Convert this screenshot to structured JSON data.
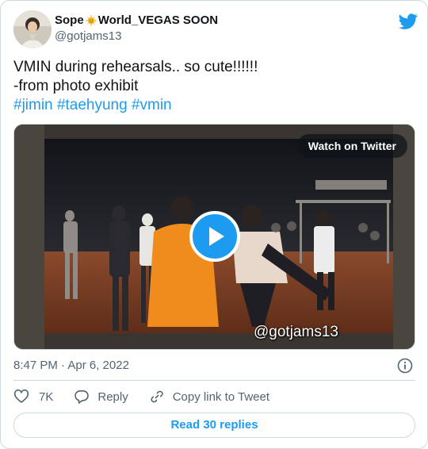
{
  "author": {
    "display_name_prefix": "Sope",
    "display_name_suffix": "World_VEGAS SOON",
    "emoji": "sun-face-emoji",
    "handle": "@gotjams13"
  },
  "tweet": {
    "line1": "VMIN during rehearsals.. so cute!!!!!!",
    "line2": "-from photo exhibit",
    "hashtags": [
      "#jimin",
      "#taehyung",
      "#vmin"
    ]
  },
  "media": {
    "watch_label": "Watch on Twitter",
    "watermark": "@gotjams13"
  },
  "timestamp": "8:47 PM · Apr 6, 2022",
  "actions": {
    "likes": "7K",
    "reply_label": "Reply",
    "copy_label": "Copy link to Tweet"
  },
  "read_replies_label": "Read 30 replies",
  "colors": {
    "accent": "#1d9bf0",
    "text": "#0f1419",
    "muted": "#536471",
    "border": "#cfd9de"
  }
}
